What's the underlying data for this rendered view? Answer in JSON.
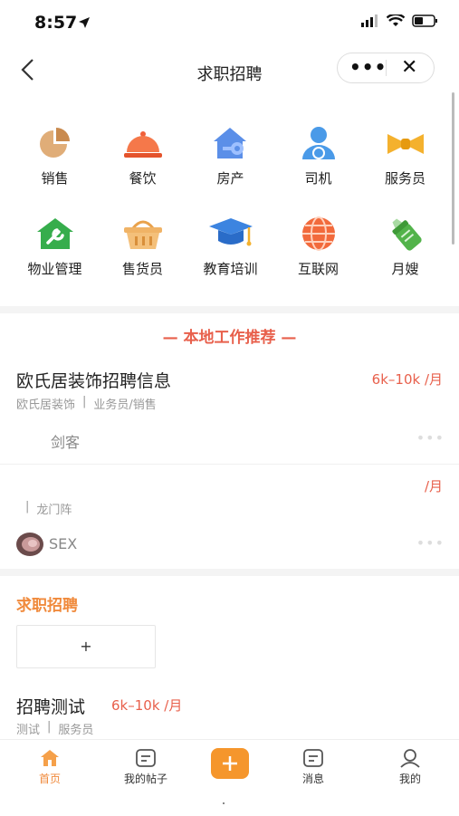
{
  "status_bar": {
    "time": "8:57"
  },
  "nav": {
    "title": "求职招聘",
    "more": "•••",
    "close": "✕",
    "back": "‹"
  },
  "categories": [
    {
      "label": "销售",
      "icon": "pie-chart-icon"
    },
    {
      "label": "餐饮",
      "icon": "cloche-icon"
    },
    {
      "label": "房产",
      "icon": "house-key-icon"
    },
    {
      "label": "司机",
      "icon": "driver-icon"
    },
    {
      "label": "服务员",
      "icon": "bow-tie-icon"
    },
    {
      "label": "物业管理",
      "icon": "house-wrench-icon"
    },
    {
      "label": "售货员",
      "icon": "basket-icon"
    },
    {
      "label": "教育培训",
      "icon": "graduation-cap-icon"
    },
    {
      "label": "互联网",
      "icon": "globe-icon"
    },
    {
      "label": "月嫂",
      "icon": "baby-bottle-icon"
    }
  ],
  "local": {
    "title": "— 本地工作推荐 —",
    "jobs": [
      {
        "title": "欧氏居装饰招聘信息",
        "salary": "6k–10k /月",
        "company": "欧氏居装饰",
        "sep": "|",
        "category": "业务员/销售",
        "user": "剑客",
        "more": "•••"
      },
      {
        "title": "",
        "salary": "/月",
        "company": "",
        "sep": "|",
        "category": "龙门阵",
        "user": "SEX",
        "more": "•••"
      }
    ]
  },
  "seek": {
    "title": "求职招聘",
    "add": "+",
    "job": {
      "title": "招聘测试",
      "salary": "6k–10k /月",
      "company": "测试",
      "sep": "|",
      "category": "服务员"
    }
  },
  "tabbar": {
    "tabs": [
      {
        "label": "首页",
        "icon": "home-icon",
        "active": true
      },
      {
        "label": "我的帖子",
        "icon": "posts-icon",
        "active": false
      },
      {
        "label": "",
        "icon": "plus-icon",
        "active": false
      },
      {
        "label": "消息",
        "icon": "message-icon",
        "active": false
      },
      {
        "label": "我的",
        "icon": "profile-icon",
        "active": false
      }
    ],
    "plus": "+"
  },
  "colors": {
    "accent": "#f08a3c",
    "salary": "#e8604c",
    "plus_button": "#f5962c"
  }
}
